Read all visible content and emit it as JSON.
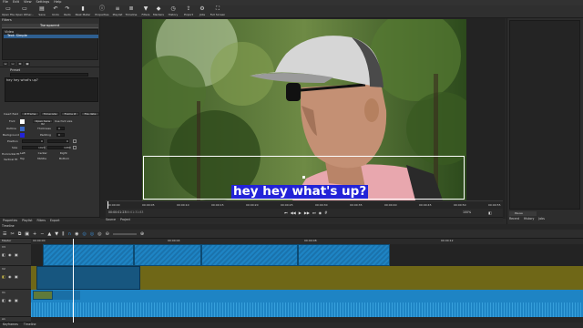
{
  "menu": [
    "File",
    "Edit",
    "View",
    "Settings",
    "Help"
  ],
  "toolbar": [
    {
      "label": "Open File",
      "icon": "folder-open-icon"
    },
    {
      "label": "Open Other...",
      "icon": "folder-icon"
    },
    {
      "label": "Save",
      "icon": "save-icon"
    },
    {
      "label": "Undo",
      "icon": "undo-icon"
    },
    {
      "label": "Redo",
      "icon": "redo-icon"
    },
    {
      "label": "Peak Meter",
      "icon": "meter-icon"
    },
    {
      "label": "Properties",
      "icon": "info-icon"
    },
    {
      "label": "Playlist",
      "icon": "list-icon"
    },
    {
      "label": "Timeline",
      "icon": "timeline-icon"
    },
    {
      "label": "Filters",
      "icon": "filter-icon"
    },
    {
      "label": "Markers",
      "icon": "marker-icon"
    },
    {
      "label": "History",
      "icon": "history-icon"
    },
    {
      "label": "Export",
      "icon": "export-icon"
    },
    {
      "label": "Jobs",
      "icon": "gear-icon"
    },
    {
      "label": "Full Screen",
      "icon": "fullscreen-icon"
    }
  ],
  "filters_panel": {
    "title": "Filters",
    "tab": "Transparent",
    "category": "Video",
    "item": "Text: Simple",
    "preset_label": "Preset",
    "text_value": "hey hey what's up?",
    "insert_field_label": "Insert field",
    "insert_buttons": [
      "# Frame",
      "Timecode",
      "Frame #",
      "File date"
    ],
    "font_label": "Font",
    "font_button": "Open Sans 82",
    "use_font_size": "Use font size",
    "outline_label": "Outline",
    "thickness_label": "Thickness",
    "thickness_value": "0",
    "background_label": "Background",
    "padding_label": "Padding",
    "padding_value": "0",
    "position_label": "Position",
    "position_x": "0",
    "position_y": "0",
    "size_label": "Size",
    "size_w": "1920",
    "size_h": "1080",
    "h_label": "Horizontal fit",
    "h_options": [
      "Left",
      "Center",
      "Right"
    ],
    "v_label": "Vertical fit",
    "v_options": [
      "Top",
      "Middle",
      "Bottom"
    ]
  },
  "viewer": {
    "subtitle": "hey hey what's up?",
    "ruler": [
      "00:00:00",
      "00:00:05",
      "00:00:10",
      "00:00:15",
      "00:00:20",
      "00:00:25",
      "00:00:30",
      "00:00:35",
      "00:00:40",
      "00:00:45",
      "00:00:50",
      "00:00:55"
    ],
    "timecode_current": "00:00:01:23",
    "timecode_total": "00:01:31:83",
    "zoom": "100%",
    "tabs": [
      "Source",
      "Project"
    ]
  },
  "left_tabs": [
    "Properties",
    "Playlist",
    "Filters",
    "Export"
  ],
  "right_panel": {
    "tab": "Recent",
    "tabs": [
      "Recent",
      "History",
      "Jobs"
    ],
    "pause_label": "Pause"
  },
  "timeline": {
    "title": "Timeline",
    "ruler": [
      "00:00:00",
      "00:00:04",
      "00:00:08",
      "00:00:12"
    ],
    "tracks": [
      {
        "name": "Master"
      },
      {
        "name": "V3"
      },
      {
        "name": "V2"
      },
      {
        "name": "V1"
      },
      {
        "name": "A1"
      }
    ],
    "bottom_tabs": [
      "Keyframes",
      "Timeline"
    ]
  },
  "colors": {
    "clip_blue": "#1e84c4",
    "clip_olive": "#6f6717",
    "subtitle_bg": "#2323d8",
    "accent": "#3a8fd8"
  }
}
